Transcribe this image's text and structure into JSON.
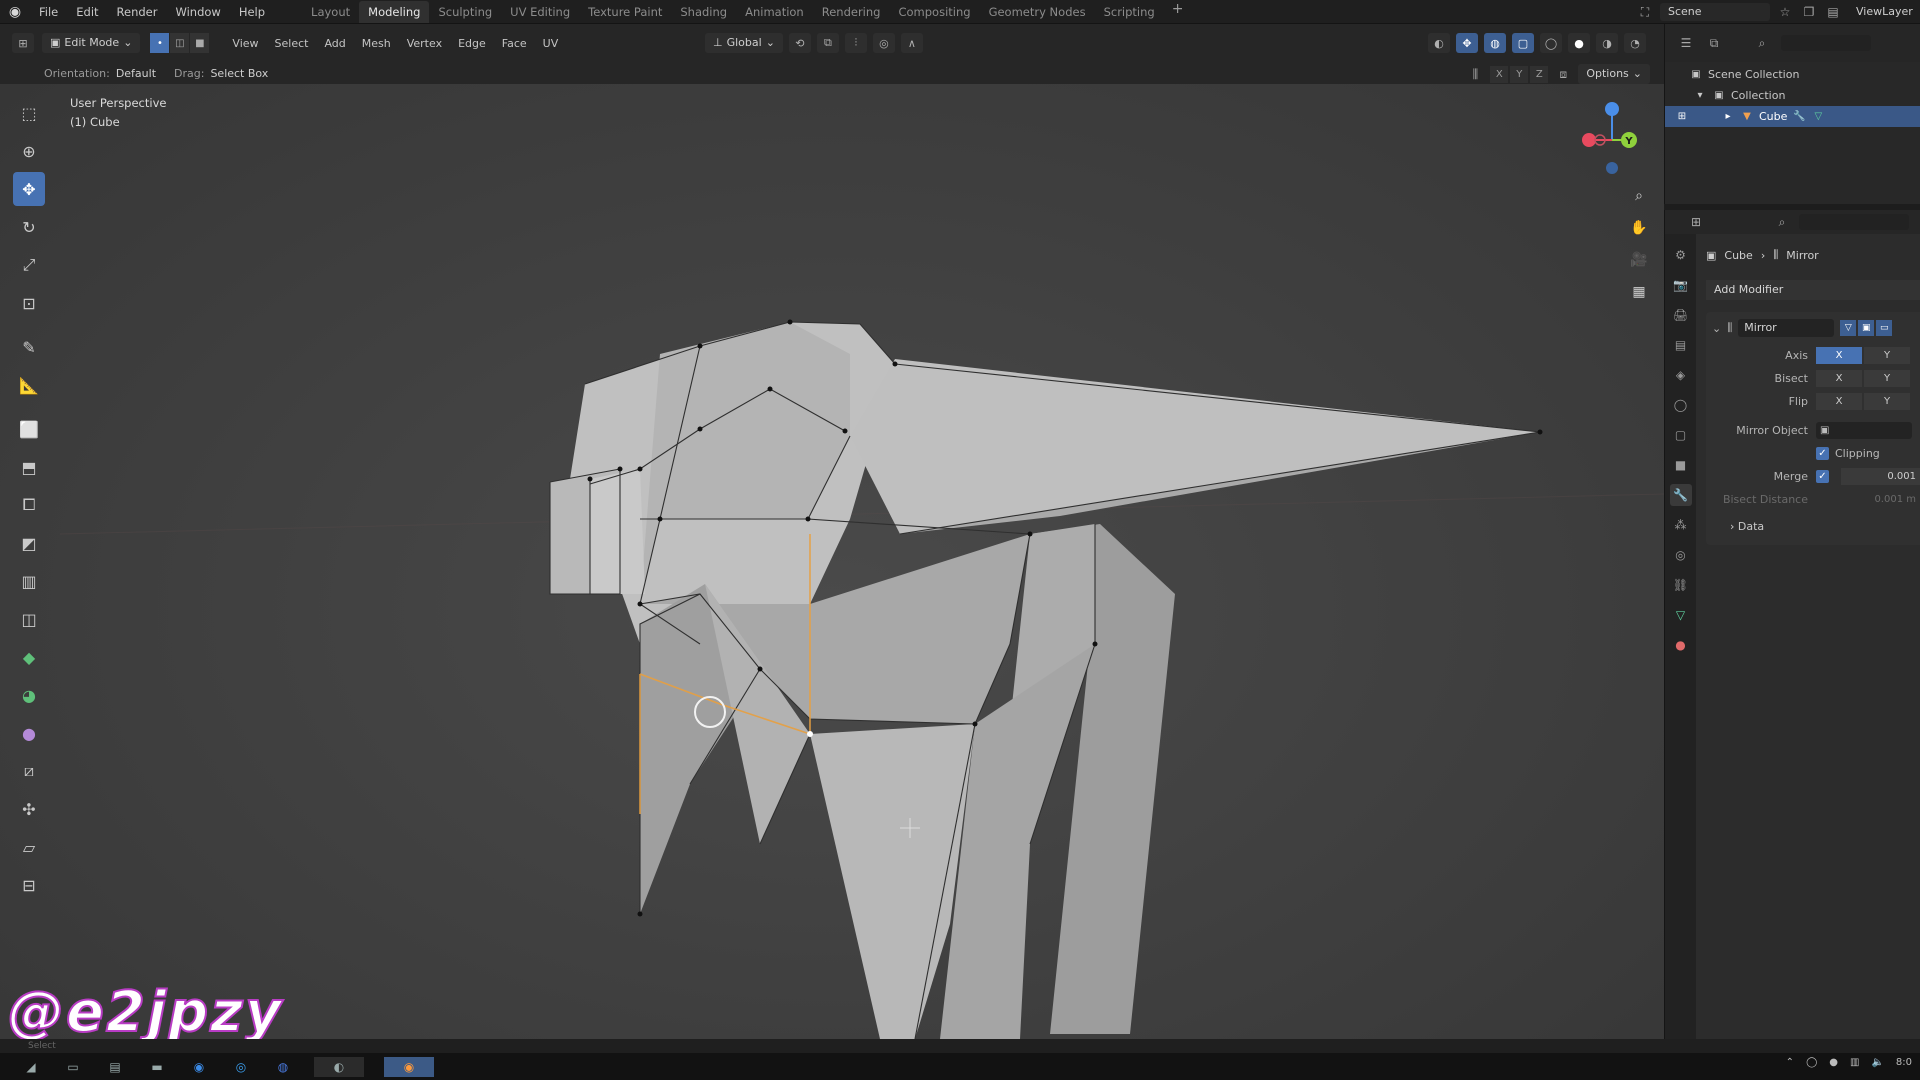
{
  "menu": {
    "items": [
      "File",
      "Edit",
      "Render",
      "Window",
      "Help"
    ]
  },
  "workspaces": {
    "tabs": [
      "Layout",
      "Modeling",
      "Sculpting",
      "UV Editing",
      "Texture Paint",
      "Shading",
      "Animation",
      "Rendering",
      "Compositing",
      "Geometry Nodes",
      "Scripting"
    ],
    "active": "Modeling",
    "add_label": "+"
  },
  "top_right": {
    "scene": "Scene",
    "view_layer": "ViewLayer"
  },
  "viewport_header": {
    "mode": "Edit Mode",
    "menus": [
      "View",
      "Select",
      "Add",
      "Mesh",
      "Vertex",
      "Edge",
      "Face",
      "UV"
    ],
    "transform_orientation": "Global"
  },
  "tool_settings": {
    "orientation_label": "Orientation:",
    "orientation_value": "Default",
    "drag_label": "Drag:",
    "drag_value": "Select Box",
    "axis_x": "X",
    "axis_y": "Y",
    "axis_z": "Z",
    "options": "Options"
  },
  "viewport": {
    "view_name": "User Perspective",
    "object_label": "(1) Cube",
    "gizmo_y_label": "Y"
  },
  "watermark": "@e2jpzy",
  "outliner": {
    "scene_collection": "Scene Collection",
    "collection": "Collection",
    "object": "Cube"
  },
  "properties": {
    "breadcrumb_object": "Cube",
    "breadcrumb_modifier": "Mirror",
    "add_modifier": "Add Modifier",
    "modifier_name": "Mirror",
    "axis_label": "Axis",
    "bisect_label": "Bisect",
    "flip_label": "Flip",
    "x": "X",
    "y": "Y",
    "mirror_object_label": "Mirror Object",
    "clipping_label": "Clipping",
    "merge_label": "Merge",
    "merge_value": "0.001",
    "bisect_distance_label": "Bisect Distance",
    "bisect_distance_value": "0.001 m",
    "data_label": "Data"
  },
  "status": {
    "text": "Select"
  },
  "taskbar": {
    "time": "8:0"
  }
}
